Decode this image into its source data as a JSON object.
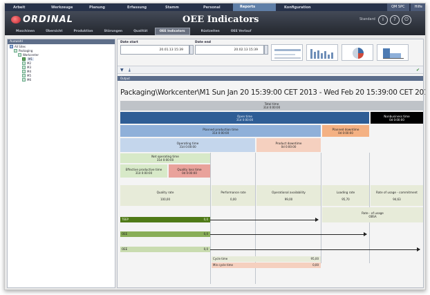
{
  "menubar": {
    "items": [
      "Arbeit",
      "Werkzeuge",
      "Planung",
      "Erfassung",
      "Stamm",
      "Personal",
      "Reports",
      "Konfiguration"
    ],
    "active_index": 6,
    "right": [
      "QM SPC",
      "Hilfe"
    ]
  },
  "header": {
    "logo": "ORDINAL",
    "title": "OEE Indicators",
    "user": "Standard",
    "icons": [
      "info-icon",
      "help-icon",
      "power-icon"
    ],
    "tabs": [
      "Maschinen",
      "Übersicht",
      "Produktion",
      "Störungen",
      "Qualität",
      "OEE Indicators",
      "Rüstzeiten",
      "OEE Verlauf"
    ],
    "active_tab": 5
  },
  "sidebar": {
    "title": "Auswahl",
    "items": [
      {
        "label": "All Sites",
        "level": 0,
        "type": "root"
      },
      {
        "label": "Packaging",
        "level": 1,
        "type": "group"
      },
      {
        "label": "Workcenter",
        "level": 2,
        "type": "group"
      },
      {
        "label": "M1",
        "level": 3,
        "type": "selected"
      },
      {
        "label": "M2",
        "level": 3,
        "type": "leaf"
      },
      {
        "label": "M3",
        "level": 3,
        "type": "leaf"
      },
      {
        "label": "M4",
        "level": 3,
        "type": "leaf"
      },
      {
        "label": "M5",
        "level": 3,
        "type": "leaf"
      },
      {
        "label": "M6",
        "level": 3,
        "type": "leaf"
      }
    ]
  },
  "filters": {
    "date_start_label": "Date start",
    "date_start": "20.01.13 15:39",
    "date_end_label": "Date end",
    "date_end": "20.02.13 15:39"
  },
  "output_tab": "Output",
  "diagram": {
    "title": "Packaging\\Workcenter\\M1  Sun Jan 20 15:39:00 CET 2013 - Wed Feb 20 15:39:00 CET 2013",
    "total_time": {
      "label": "Total time",
      "value": "31d 0:00:00"
    },
    "open_time": {
      "label": "Open time",
      "value": "31d 0:00:00"
    },
    "nonbusiness_time": {
      "label": "Nonbusiness time",
      "value": "0d 0:00:00"
    },
    "planned_production": {
      "label": "Planned production time",
      "value": "31d 0:00:00"
    },
    "planned_downtime": {
      "label": "Planned downtime",
      "value": "0d 0:00:00"
    },
    "operating_time": {
      "label": "Operating time",
      "value": "31d 0:00:00"
    },
    "product_downtime": {
      "label": "Product downtime",
      "value": "0d 0:00:00"
    },
    "net_operating": {
      "label": "Net operating time",
      "value": "31d 0:00:00"
    },
    "effective_production": {
      "label": "Effective productive time",
      "value": "31d 0:00:00"
    },
    "quality_loss": {
      "label": "Quality loss time",
      "value": "0d 0:00:00"
    },
    "indicators": [
      {
        "label": "Quality rate",
        "value": "100,00"
      },
      {
        "label": "Performance rate",
        "value": "0,00"
      },
      {
        "label": "Operational availability",
        "value": "99,00"
      },
      {
        "label": "Loading rate",
        "value": "95,70"
      },
      {
        "label": "Rate of usage - commitment",
        "value": "94,63"
      }
    ],
    "rate_of_usage": {
      "label": "Rate - of usage",
      "value": "OBSA"
    },
    "bars": [
      {
        "label": "TEEP",
        "value": "0,0"
      },
      {
        "label": "OEE",
        "value": "0,0"
      },
      {
        "label": "OEE",
        "value": "0,0"
      }
    ],
    "cycle": {
      "label": "Cycle time",
      "value": "95,00",
      "label2": "Min cycle time",
      "value2": "0,00"
    }
  },
  "colors": {
    "dark_blue": "#2e5d95",
    "mid_blue": "#8fb0d9",
    "light_blue": "#c4d6ec",
    "orange": "#f4b183",
    "peach": "#f5d0bf",
    "green_light": "#d7e9c8",
    "red_light": "#e9a29b",
    "cream": "#e7ebd9",
    "gray": "#bfc3c8",
    "bar_green": "#4f7a17",
    "bar_mid": "#89ae58",
    "bar_light": "#c9dcb0",
    "black": "#000000"
  }
}
